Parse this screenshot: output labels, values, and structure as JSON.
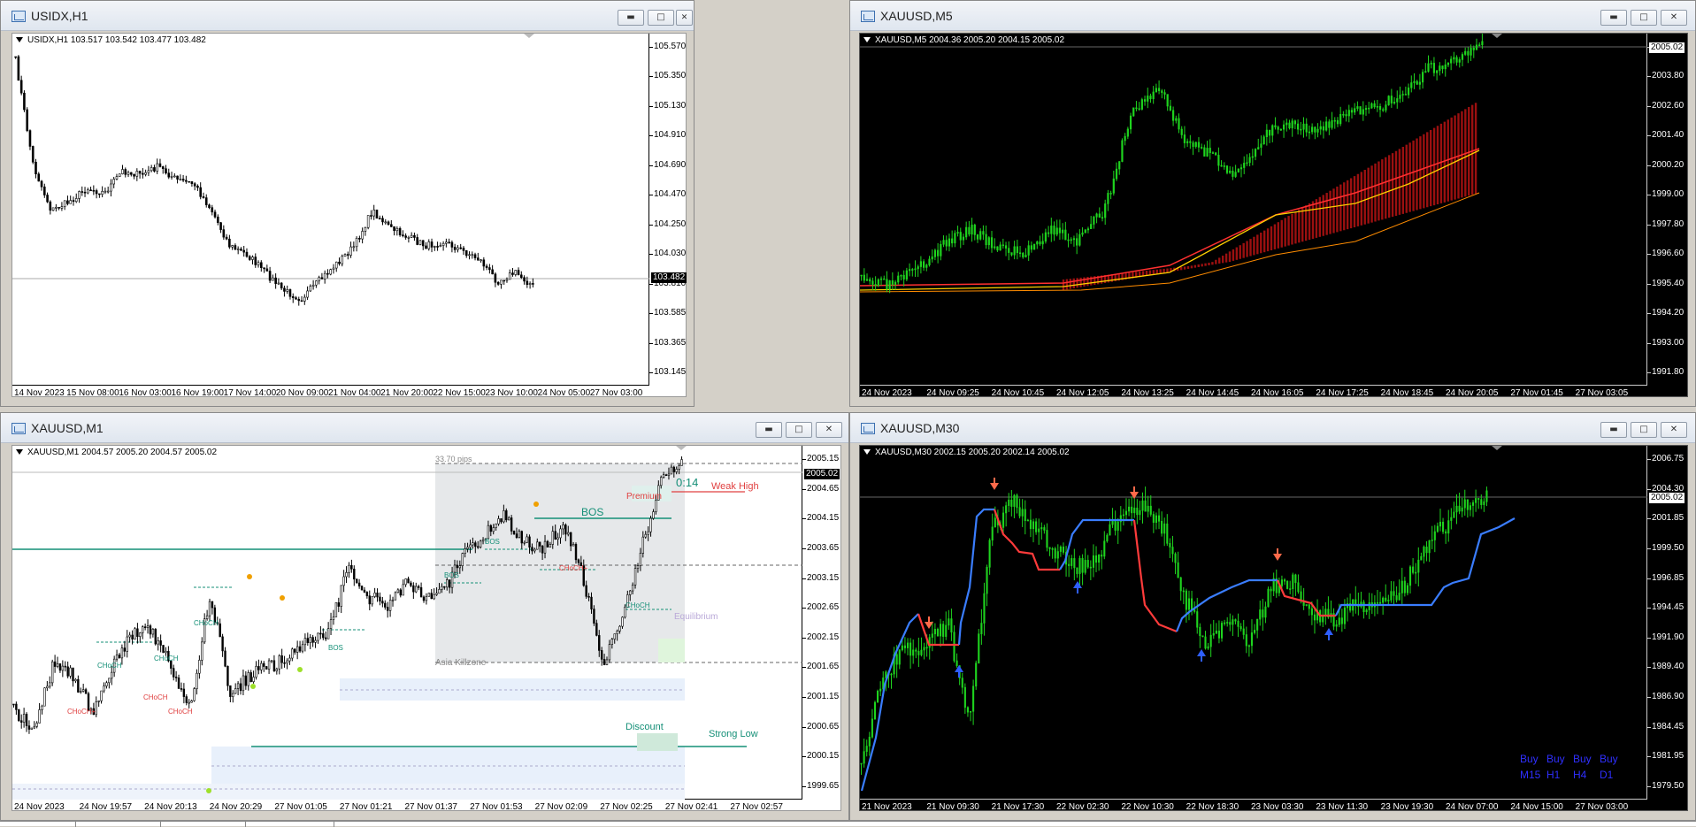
{
  "windows": {
    "usidx": {
      "title": "USIDX,H1",
      "header": "USIDX,H1  103.517 103.542 103.477 103.482",
      "yaxis": [
        "105.570",
        "105.350",
        "105.130",
        "104.910",
        "104.690",
        "104.470",
        "104.250",
        "104.030",
        "103.810",
        "103.585",
        "103.365",
        "103.145"
      ],
      "current_price": "103.482",
      "xaxis": [
        "14 Nov 2023",
        "15 Nov 08:00",
        "16 Nov 03:00",
        "16 Nov 19:00",
        "17 Nov 14:00",
        "20 Nov 09:00",
        "21 Nov 04:00",
        "21 Nov 20:00",
        "22 Nov 15:00",
        "23 Nov 10:00",
        "24 Nov 05:00",
        "27 Nov 03:00"
      ]
    },
    "xau_m5": {
      "title": "XAUUSD,M5",
      "header": "XAUUSD,M5  2004.36 2005.20 2004.15 2005.02",
      "yaxis": [
        "2005.02",
        "2003.80",
        "2002.60",
        "2001.40",
        "2000.20",
        "1999.00",
        "1997.80",
        "1996.60",
        "1995.40",
        "1994.20",
        "1993.00",
        "1991.80"
      ],
      "current_price": "2005.02",
      "xaxis": [
        "24 Nov 2023",
        "24 Nov 09:25",
        "24 Nov 10:45",
        "24 Nov 12:05",
        "24 Nov 13:25",
        "24 Nov 14:45",
        "24 Nov 16:05",
        "24 Nov 17:25",
        "24 Nov 18:45",
        "24 Nov 20:05",
        "27 Nov 01:45",
        "27 Nov 03:05"
      ]
    },
    "xau_m1": {
      "title": "XAUUSD,M1",
      "header": "XAUUSD,M1  2004.57 2005.20 2004.57 2005.02",
      "yaxis": [
        "2005.15",
        "2004.65",
        "2004.15",
        "2003.65",
        "2003.15",
        "2002.65",
        "2002.15",
        "2001.65",
        "2001.15",
        "2000.65",
        "2000.15",
        "1999.65"
      ],
      "current_price": "2005.02",
      "xaxis": [
        "24 Nov 2023",
        "24 Nov 19:57",
        "24 Nov 20:13",
        "24 Nov 20:29",
        "27 Nov 01:05",
        "27 Nov 01:21",
        "27 Nov 01:37",
        "27 Nov 01:53",
        "27 Nov 02:09",
        "27 Nov 02:25",
        "27 Nov 02:41",
        "27 Nov 02:57"
      ],
      "annotations": {
        "pips": "33.70 pips",
        "timer": "0:14",
        "weak_high": "Weak High",
        "premium": "Premium",
        "bos_main": "BOS",
        "bos": "BOS",
        "choch": "CHoCH",
        "choch_plus": "CHoCH+",
        "equilibrium": "Equilibrium",
        "killzone": "Asia Killzone",
        "discount": "Discount",
        "strong_low": "Strong Low"
      }
    },
    "xau_m30": {
      "title": "XAUUSD,M30",
      "header": "XAUUSD,M30  2002.15 2005.20 2002.14 2005.02",
      "yaxis": [
        "2006.75",
        "2004.30",
        "2001.85",
        "1999.50",
        "1996.85",
        "1994.45",
        "1991.90",
        "1989.40",
        "1986.90",
        "1984.45",
        "1981.95",
        "1979.50"
      ],
      "current_price": "2005.02",
      "xaxis": [
        "21 Nov 2023",
        "21 Nov 09:30",
        "21 Nov 17:30",
        "22 Nov 02:30",
        "22 Nov 10:30",
        "22 Nov 18:30",
        "23 Nov 03:30",
        "23 Nov 11:30",
        "23 Nov 19:30",
        "24 Nov 07:00",
        "24 Nov 15:00",
        "27 Nov 03:00"
      ],
      "signals": {
        "buy": [
          "Buy",
          "Buy",
          "Buy",
          "Buy"
        ],
        "tf": [
          "M15",
          "H1",
          "H4",
          "D1"
        ]
      }
    }
  },
  "colors": {
    "bull_green": "#1fd41f",
    "bear_red": "#ff3b3b",
    "line_blue": "#3a7dff",
    "teal": "#148f77",
    "annotation_red": "#e04040"
  }
}
